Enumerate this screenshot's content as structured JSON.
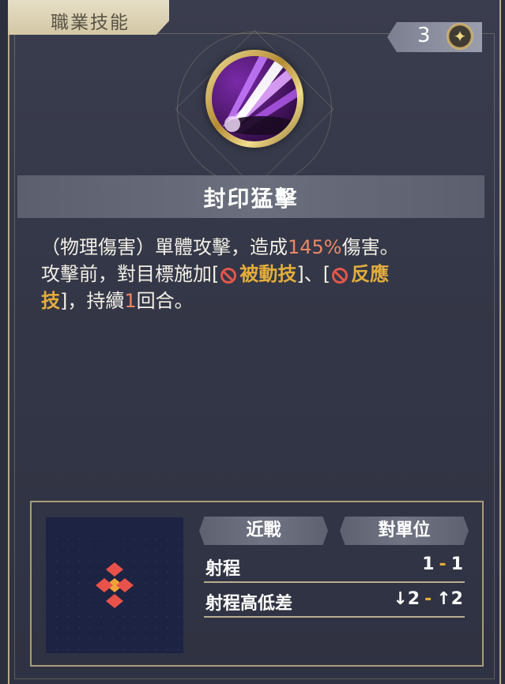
{
  "header": {
    "title": "職業技能"
  },
  "counter": {
    "value": "3",
    "icon": "sparkle-icon"
  },
  "skill": {
    "name": "封印猛擊",
    "icon": "purple-slash-icon",
    "description": {
      "p1": "（物理傷害）單體攻擊，造成",
      "damage": "145%",
      "p2": "傷害。",
      "p3": "攻擊前，對目標施加[",
      "effect1": "被動技",
      "p4": "]、[",
      "effect2a": "反應",
      "effect2b": "技",
      "p5": "]，持續",
      "turns": "1",
      "p6": "回合。"
    }
  },
  "range": {
    "tag_melee": "近戰",
    "tag_target": "對單位",
    "range_label": "射程",
    "range_min": "1",
    "range_max": "1",
    "height_label": "射程高低差",
    "height_down": "↓2",
    "height_up": "↑2",
    "separator": "-"
  },
  "colors": {
    "highlight_value": "#ec8764",
    "highlight_effect": "#e3ad3b",
    "ban_icon": "#e0574a",
    "grid_cell_orange": "#f2a23a",
    "grid_cell_red": "#e8524a"
  }
}
